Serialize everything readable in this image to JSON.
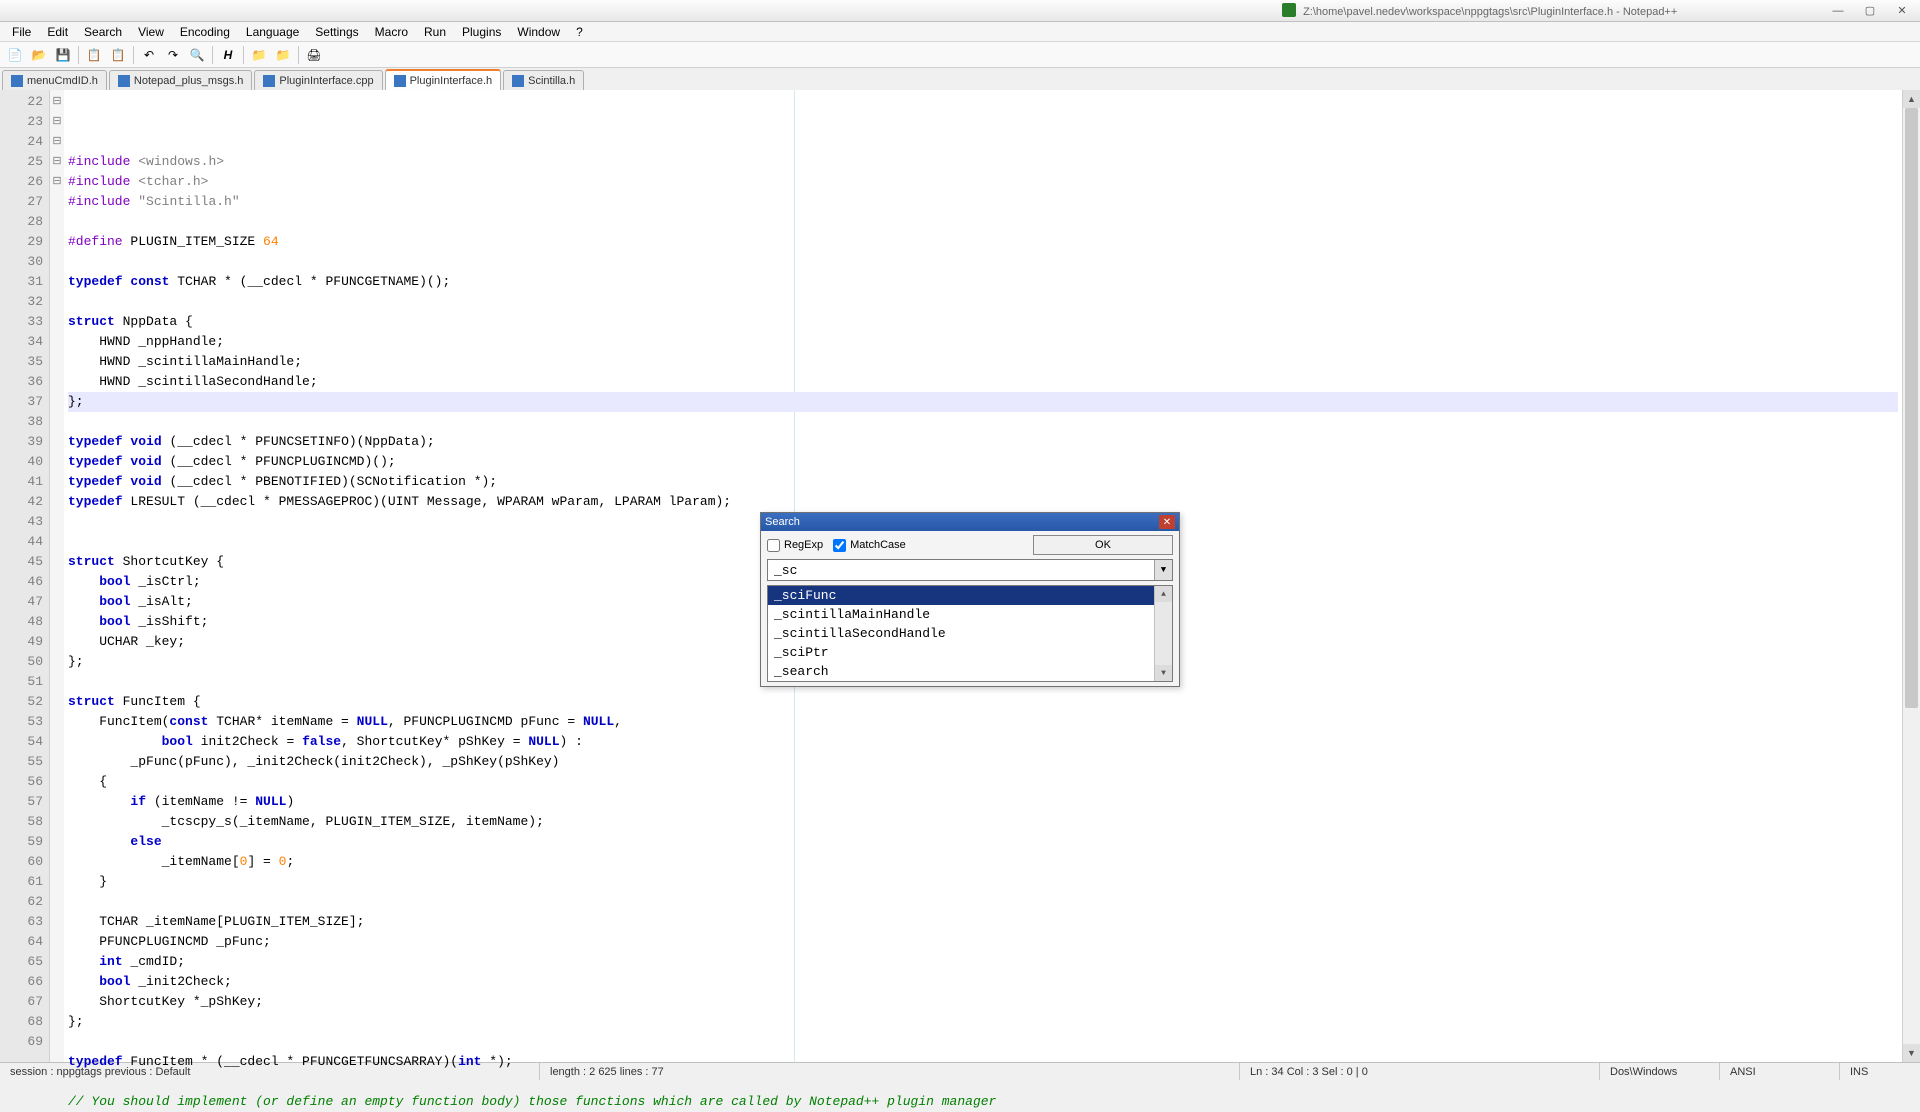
{
  "titlebar_text": "Z:\\home\\pavel.nedev\\workspace\\nppgtags\\src\\PluginInterface.h - Notepad++",
  "menus": [
    "File",
    "Edit",
    "Search",
    "View",
    "Encoding",
    "Language",
    "Settings",
    "Macro",
    "Run",
    "Plugins",
    "Window",
    "?"
  ],
  "tabs": [
    {
      "label": "menuCmdID.h",
      "active": false
    },
    {
      "label": "Notepad_plus_msgs.h",
      "active": false
    },
    {
      "label": "PluginInterface.cpp",
      "active": false
    },
    {
      "label": "PluginInterface.h",
      "active": true
    },
    {
      "label": "Scintilla.h",
      "active": false
    }
  ],
  "first_line": 22,
  "highlighted_line_index": 12,
  "fold_markers": {
    "8": "⊟",
    "20": "⊟",
    "27": "⊟",
    "31": "⊟",
    "46": "⊟"
  },
  "code_lines": [
    "#include <windows.h>",
    "#include <tchar.h>",
    "#include \"Scintilla.h\"",
    "",
    "#define PLUGIN_ITEM_SIZE 64",
    "",
    "typedef const TCHAR * (__cdecl * PFUNCGETNAME)();",
    "",
    "struct NppData {",
    "    HWND _nppHandle;",
    "    HWND _scintillaMainHandle;",
    "    HWND _scintillaSecondHandle;",
    "};",
    "",
    "typedef void (__cdecl * PFUNCSETINFO)(NppData);",
    "typedef void (__cdecl * PFUNCPLUGINCMD)();",
    "typedef void (__cdecl * PBENOTIFIED)(SCNotification *);",
    "typedef LRESULT (__cdecl * PMESSAGEPROC)(UINT Message, WPARAM wParam, LPARAM lParam);",
    "",
    "",
    "struct ShortcutKey {",
    "    bool _isCtrl;",
    "    bool _isAlt;",
    "    bool _isShift;",
    "    UCHAR _key;",
    "};",
    "",
    "struct FuncItem {",
    "    FuncItem(const TCHAR* itemName = NULL, PFUNCPLUGINCMD pFunc = NULL,",
    "            bool init2Check = false, ShortcutKey* pShKey = NULL) :",
    "        _pFunc(pFunc), _init2Check(init2Check), _pShKey(pShKey)",
    "    {",
    "        if (itemName != NULL)",
    "            _tcscpy_s(_itemName, PLUGIN_ITEM_SIZE, itemName);",
    "        else",
    "            _itemName[0] = 0;",
    "    }",
    "",
    "    TCHAR _itemName[PLUGIN_ITEM_SIZE];",
    "    PFUNCPLUGINCMD _pFunc;",
    "    int _cmdID;",
    "    bool _init2Check;",
    "    ShortcutKey *_pShKey;",
    "};",
    "",
    "typedef FuncItem * (__cdecl * PFUNCGETFUNCSARRAY)(int *);",
    "",
    "// You should implement (or define an empty function body) those functions which are called by Notepad++ plugin manager"
  ],
  "search": {
    "title": "Search",
    "regexp_label": "RegExp",
    "regexp_checked": false,
    "matchcase_label": "MatchCase",
    "matchcase_checked": true,
    "ok_label": "OK",
    "input_value": "_sc",
    "items": [
      "_sciFunc",
      "_scintillaMainHandle",
      "_scintillaSecondHandle",
      "_sciPtr",
      "_search"
    ],
    "selected_index": 0
  },
  "status": {
    "left": "session : nppgtags    previous : Default",
    "length": "length : 2 625    lines : 77",
    "pos": "Ln : 34    Col : 3    Sel : 0 | 0",
    "eol": "Dos\\Windows",
    "enc": "ANSI",
    "mode": "INS"
  }
}
